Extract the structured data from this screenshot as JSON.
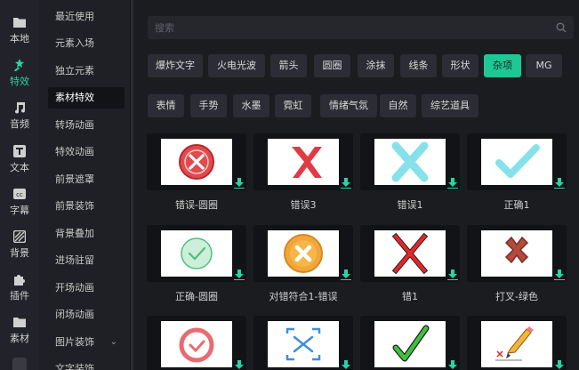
{
  "rail": {
    "items": [
      {
        "label": "本地",
        "icon": "folder-icon"
      },
      {
        "label": "特效",
        "icon": "magic-wand-icon"
      },
      {
        "label": "音频",
        "icon": "music-note-icon"
      },
      {
        "label": "文本",
        "icon": "text-icon"
      },
      {
        "label": "字幕",
        "icon": "subtitle-icon"
      },
      {
        "label": "背景",
        "icon": "background-icon"
      },
      {
        "label": "插件",
        "icon": "puzzle-icon"
      },
      {
        "label": "素材",
        "icon": "material-folder-icon"
      }
    ],
    "active_index": 1
  },
  "categories": {
    "items": [
      {
        "label": "最近使用"
      },
      {
        "label": "元素入场"
      },
      {
        "label": "独立元素"
      },
      {
        "label": "素材特效"
      },
      {
        "label": "转场动画"
      },
      {
        "label": "特效动画"
      },
      {
        "label": "前景遮罩"
      },
      {
        "label": "前景装饰"
      },
      {
        "label": "背景叠加"
      },
      {
        "label": "进场驻留"
      },
      {
        "label": "开场动画"
      },
      {
        "label": "闭场动画"
      },
      {
        "label": "图片装饰"
      },
      {
        "label": "文字装饰"
      }
    ],
    "active_index": 3,
    "expandable_index": 12
  },
  "search": {
    "placeholder": "搜索"
  },
  "tags": {
    "row1": [
      "爆炸文字",
      "火电光波",
      "箭头",
      "圆圈",
      "涂抹",
      "线条",
      "形状",
      "杂项",
      "MG"
    ],
    "row2": [
      "表情",
      "手势",
      "水墨",
      "霓虹",
      "情绪气氛",
      "自然",
      "综艺道具"
    ],
    "active": "杂项"
  },
  "cards": [
    {
      "label": "错误-圆圈",
      "icon": "red-circle-x-icon"
    },
    {
      "label": "错误3",
      "icon": "red-x-icon"
    },
    {
      "label": "错误1",
      "icon": "cyan-x-icon"
    },
    {
      "label": "正确1",
      "icon": "cyan-checkmark-icon"
    },
    {
      "label": "正确-圆圈",
      "icon": "green-circle-check-icon"
    },
    {
      "label": "对错符合1-错误",
      "icon": "orange-circle-x-icon"
    },
    {
      "label": "错1",
      "icon": "red-x-outline-icon"
    },
    {
      "label": "打叉-绿色",
      "icon": "pixel-x-icon"
    },
    {
      "label": "",
      "icon": "red-ring-check-icon"
    },
    {
      "label": "",
      "icon": "blue-bracket-x-icon"
    },
    {
      "label": "",
      "icon": "green-checkmark-icon"
    },
    {
      "label": "",
      "icon": "pencil-icon"
    }
  ],
  "colors": {
    "accent": "#1fc794",
    "download": "#2ad3a4",
    "panel": "#1b1c20"
  }
}
